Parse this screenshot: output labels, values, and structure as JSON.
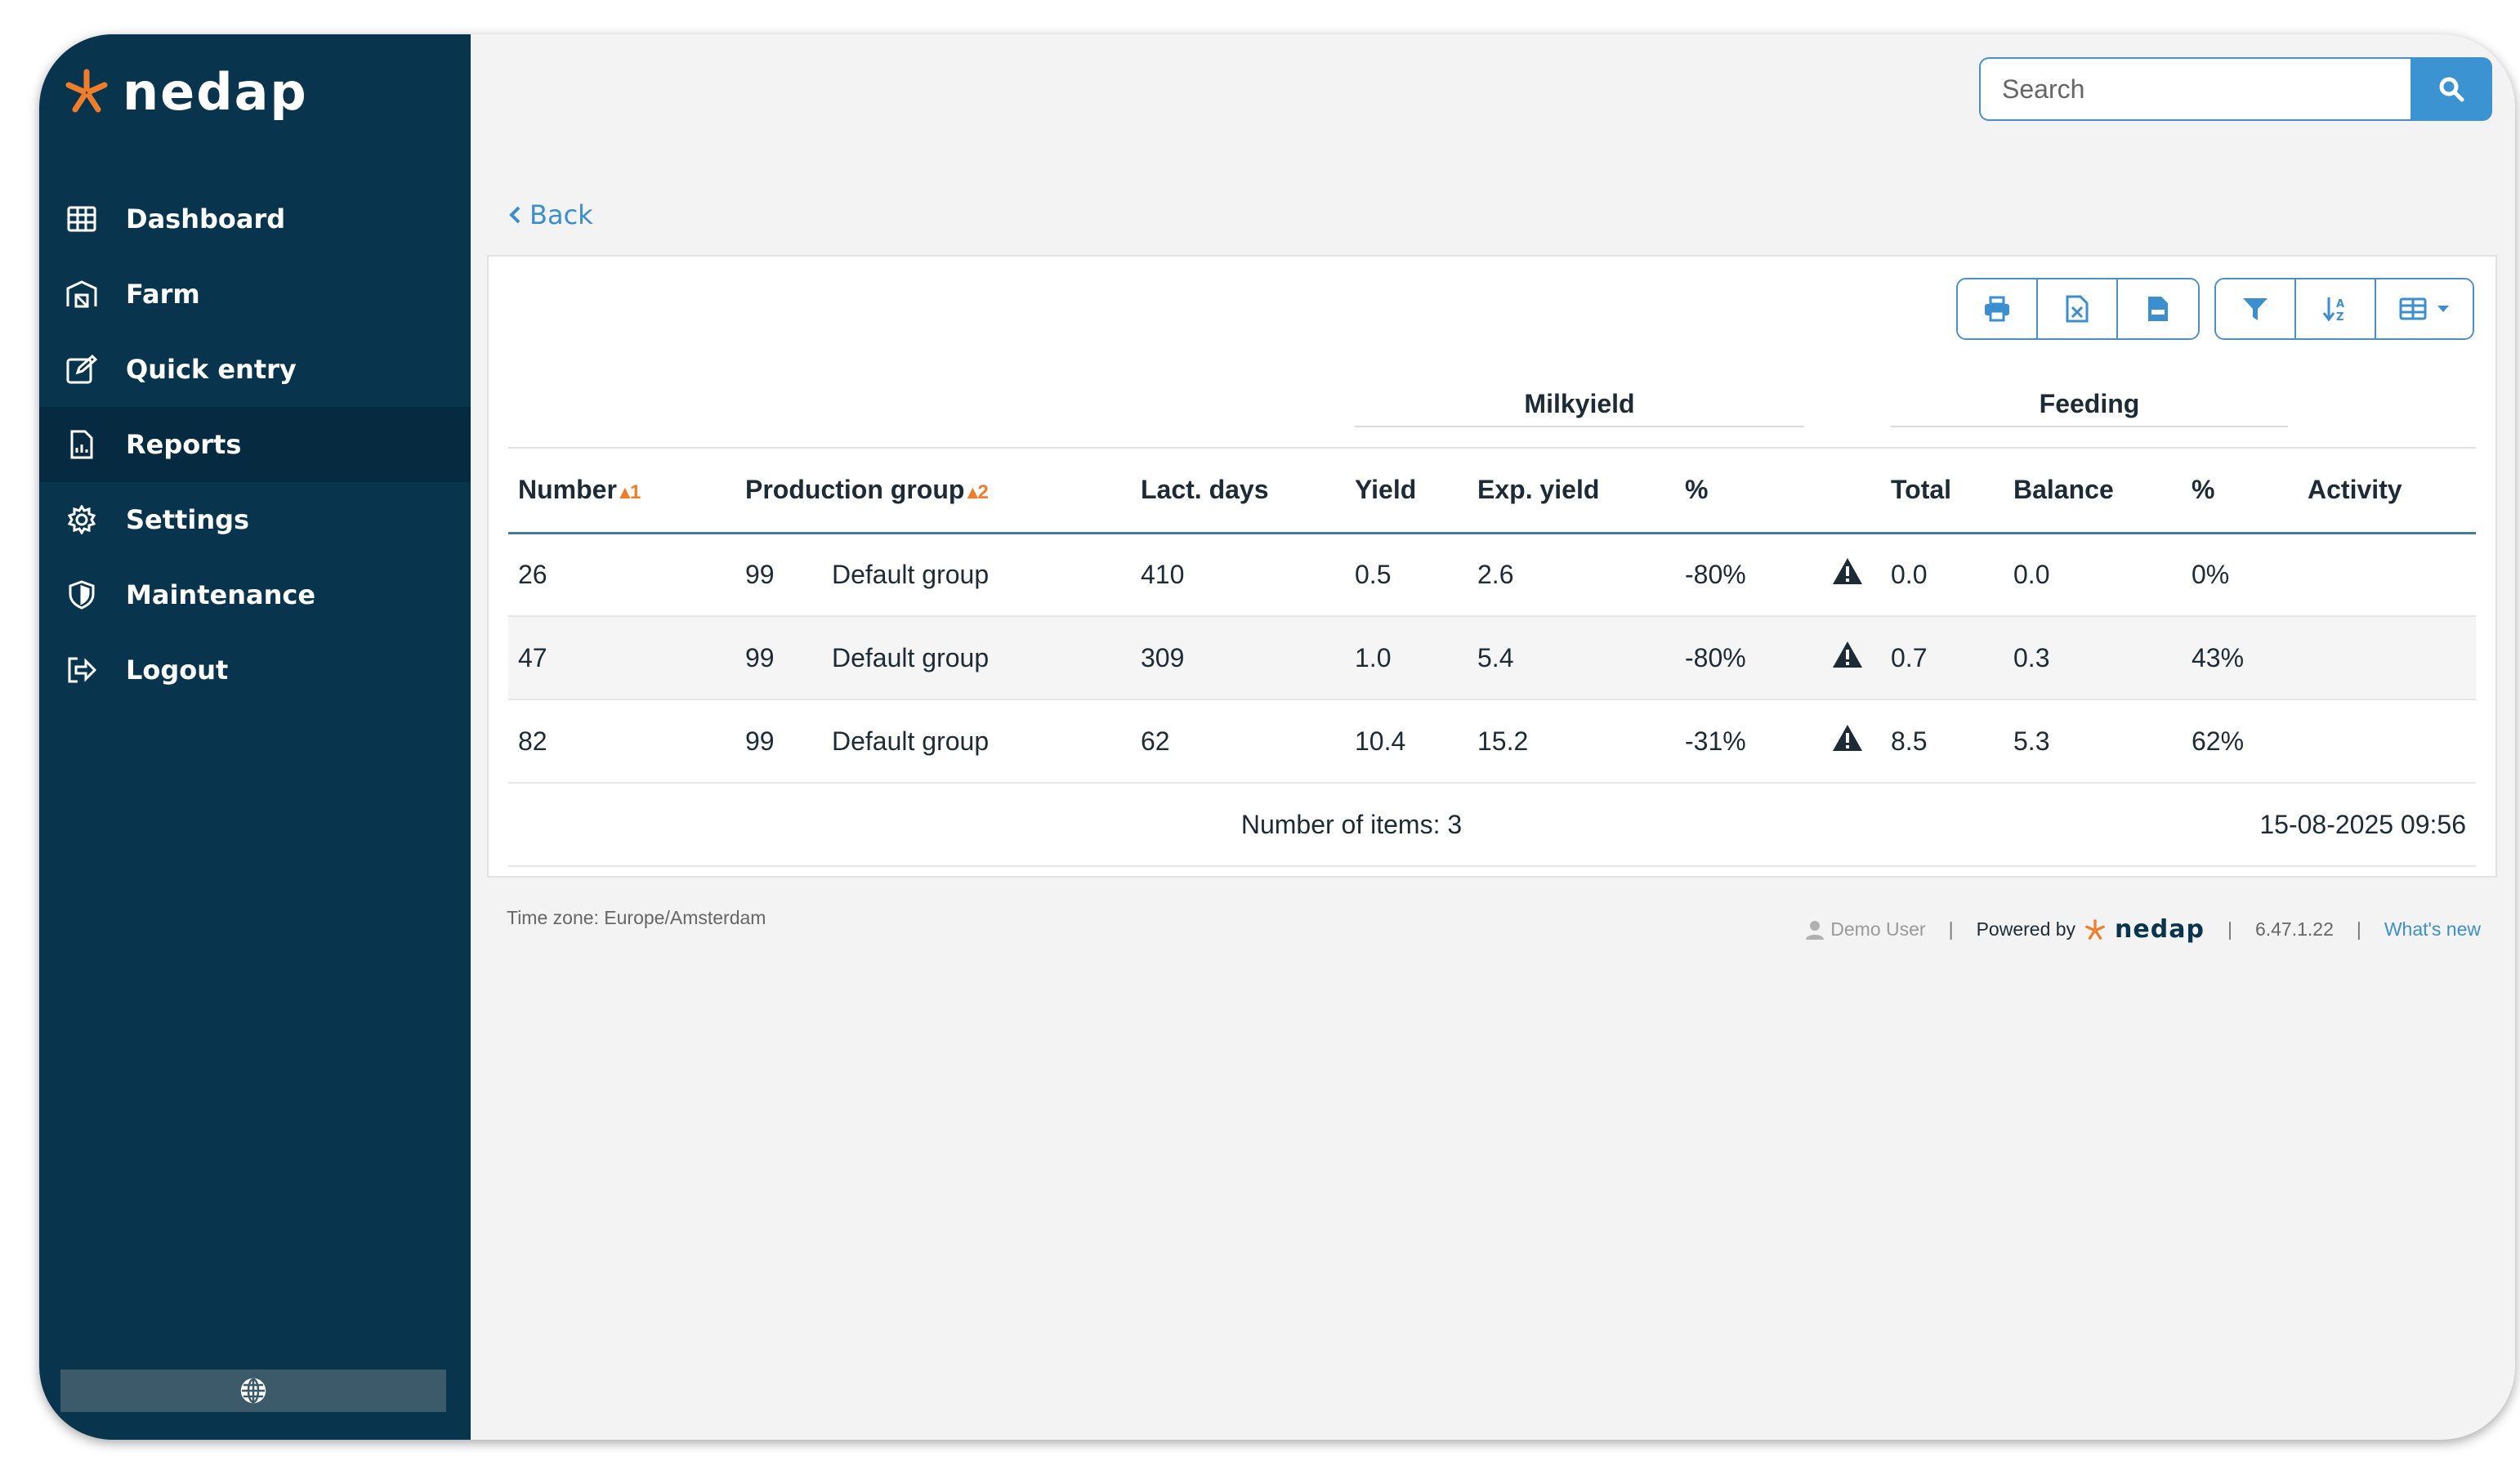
{
  "brand": {
    "name": "nedap",
    "accent": "#ef7d2a",
    "sidebar_bg": "#08344d"
  },
  "sidebar": {
    "items": [
      {
        "label": "Dashboard",
        "icon": "grid-icon"
      },
      {
        "label": "Farm",
        "icon": "barn-icon"
      },
      {
        "label": "Quick entry",
        "icon": "edit-icon"
      },
      {
        "label": "Reports",
        "icon": "report-icon",
        "active": true
      },
      {
        "label": "Settings",
        "icon": "gear-icon"
      },
      {
        "label": "Maintenance",
        "icon": "shield-icon"
      },
      {
        "label": "Logout",
        "icon": "logout-icon"
      }
    ],
    "language_icon": "globe-icon"
  },
  "search": {
    "placeholder": "Search"
  },
  "back": {
    "label": "Back"
  },
  "toolbar": {
    "buttons": [
      "print-icon",
      "excel-icon",
      "csv-icon",
      "filter-icon",
      "sort-icon",
      "columns-icon"
    ]
  },
  "table": {
    "groups": {
      "milkyield": "Milkyield",
      "feeding": "Feeding"
    },
    "headers": {
      "number": "Number",
      "number_sort": "1",
      "production_group": "Production group",
      "production_group_sort": "2",
      "lact_days": "Lact. days",
      "yield": "Yield",
      "exp_yield": "Exp. yield",
      "milk_pct": "%",
      "total": "Total",
      "balance": "Balance",
      "feed_pct": "%",
      "activity": "Activity"
    },
    "rows": [
      {
        "number": "26",
        "group_id": "99",
        "group_name": "Default group",
        "lact_days": "410",
        "yield": "0.5",
        "exp_yield": "2.6",
        "milk_pct": "-80%",
        "total": "0.0",
        "balance": "0.0",
        "feed_pct": "0%",
        "activity": ""
      },
      {
        "number": "47",
        "group_id": "99",
        "group_name": "Default group",
        "lact_days": "309",
        "yield": "1.0",
        "exp_yield": "5.4",
        "milk_pct": "-80%",
        "total": "0.7",
        "balance": "0.3",
        "feed_pct": "43%",
        "activity": ""
      },
      {
        "number": "82",
        "group_id": "99",
        "group_name": "Default group",
        "lact_days": "62",
        "yield": "10.4",
        "exp_yield": "15.2",
        "milk_pct": "-31%",
        "total": "8.5",
        "balance": "5.3",
        "feed_pct": "62%",
        "activity": ""
      }
    ],
    "item_count": "Number of items: 3",
    "timestamp": "15-08-2025 09:56"
  },
  "footer": {
    "timezone": "Time zone: Europe/Amsterdam",
    "user": "Demo User",
    "powered_by": "Powered by",
    "version": "6.47.1.22",
    "whats_new": "What's new",
    "separator": "|"
  }
}
